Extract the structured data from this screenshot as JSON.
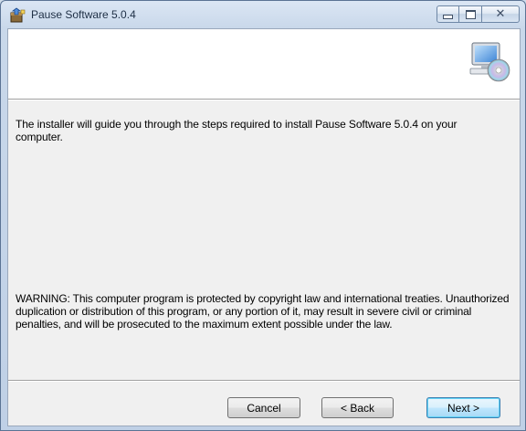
{
  "window": {
    "title": "Pause Software 5.0.4",
    "icon": "installer-box-icon",
    "controls": {
      "minimize": "minimize-icon",
      "maximize": "maximize-icon",
      "close": "close-icon"
    }
  },
  "banner": {
    "icon": "computer-cd-icon"
  },
  "content": {
    "intro": "The installer will guide you through the steps required to install Pause Software 5.0.4 on your computer.",
    "warning": "WARNING: This computer program is protected by copyright law and international treaties. Unauthorized duplication or distribution of this program, or any portion of it, may result in severe civil or criminal penalties, and will be prosecuted to the maximum extent possible under the law."
  },
  "buttons": {
    "cancel": "Cancel",
    "back": "< Back",
    "next": "Next >"
  },
  "colors": {
    "dialog_background": "#f0f0f0",
    "banner_background": "#ffffff",
    "default_button_border": "#3c7fb1"
  }
}
